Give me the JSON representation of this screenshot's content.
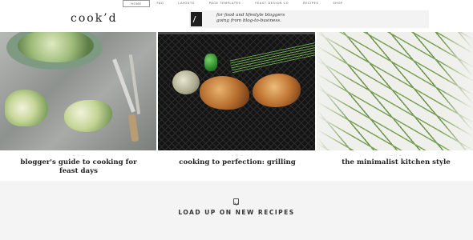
{
  "nav": {
    "items": [
      {
        "label": "home",
        "active": true
      },
      {
        "label": "faq",
        "active": false
      },
      {
        "label": "layouts",
        "active": false
      },
      {
        "label": "page templates",
        "active": false
      },
      {
        "label": "feast design co",
        "active": false
      },
      {
        "label": "recipes",
        "active": false
      },
      {
        "label": "shop",
        "active": false
      }
    ]
  },
  "header": {
    "logo": "cook’d",
    "banner_text_line1": "for food and lifestyle bloggers",
    "banner_text_line2": "going from blog-to-business."
  },
  "posts": [
    {
      "meta": "—  ○  —",
      "title": "blogger's guide to cooking for feast days",
      "image": "cabbage-on-marble"
    },
    {
      "meta": "—  ○  —",
      "title": "cooking to perfection: grilling",
      "image": "grilled-chicken"
    },
    {
      "meta": "—  ○  —",
      "title": "the minimalist kitchen style",
      "image": "green-beans"
    }
  ],
  "load": {
    "icon": "bookmark-icon",
    "text": "load up on new recipes"
  },
  "colors": {
    "text": "#222222",
    "muted": "#aaaaaa",
    "panel": "#f4f4f4"
  }
}
